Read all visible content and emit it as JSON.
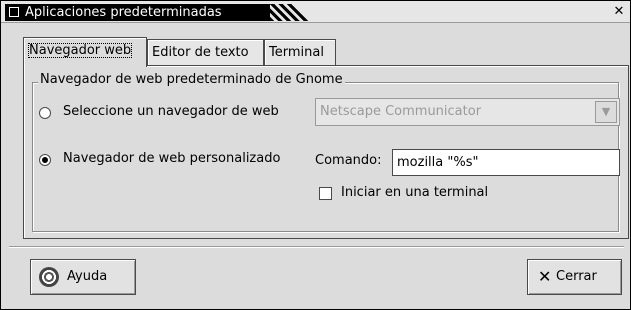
{
  "window": {
    "title": "Aplicaciones predeterminadas",
    "close_glyph": "✕"
  },
  "tabs": [
    {
      "label": "Navegador web",
      "active": true
    },
    {
      "label": "Editor de texto",
      "active": false
    },
    {
      "label": "Terminal",
      "active": false
    }
  ],
  "panel": {
    "frame_label": "Navegador de web predeterminado de Gnome",
    "option_select": {
      "label": "Seleccione un navegador de web",
      "selected": false,
      "combo_value": "Netscape Communicator"
    },
    "option_custom": {
      "label": "Navegador de web personalizado",
      "selected": true,
      "command_label": "Comando:",
      "command_value": "mozilla \"%s\"",
      "terminal_checkbox_label": "Iniciar en una terminal",
      "terminal_checked": false
    }
  },
  "buttons": {
    "help_label": "Ayuda",
    "help_mnemonic": "y",
    "close_label": "Cerrar",
    "close_mnemonic": "C"
  },
  "icons": {
    "window_icon": "window-icon",
    "help_icon": "help-lifebuoy-icon",
    "close_icon": "x-icon",
    "dropdown_icon": "chevron-down-icon"
  }
}
